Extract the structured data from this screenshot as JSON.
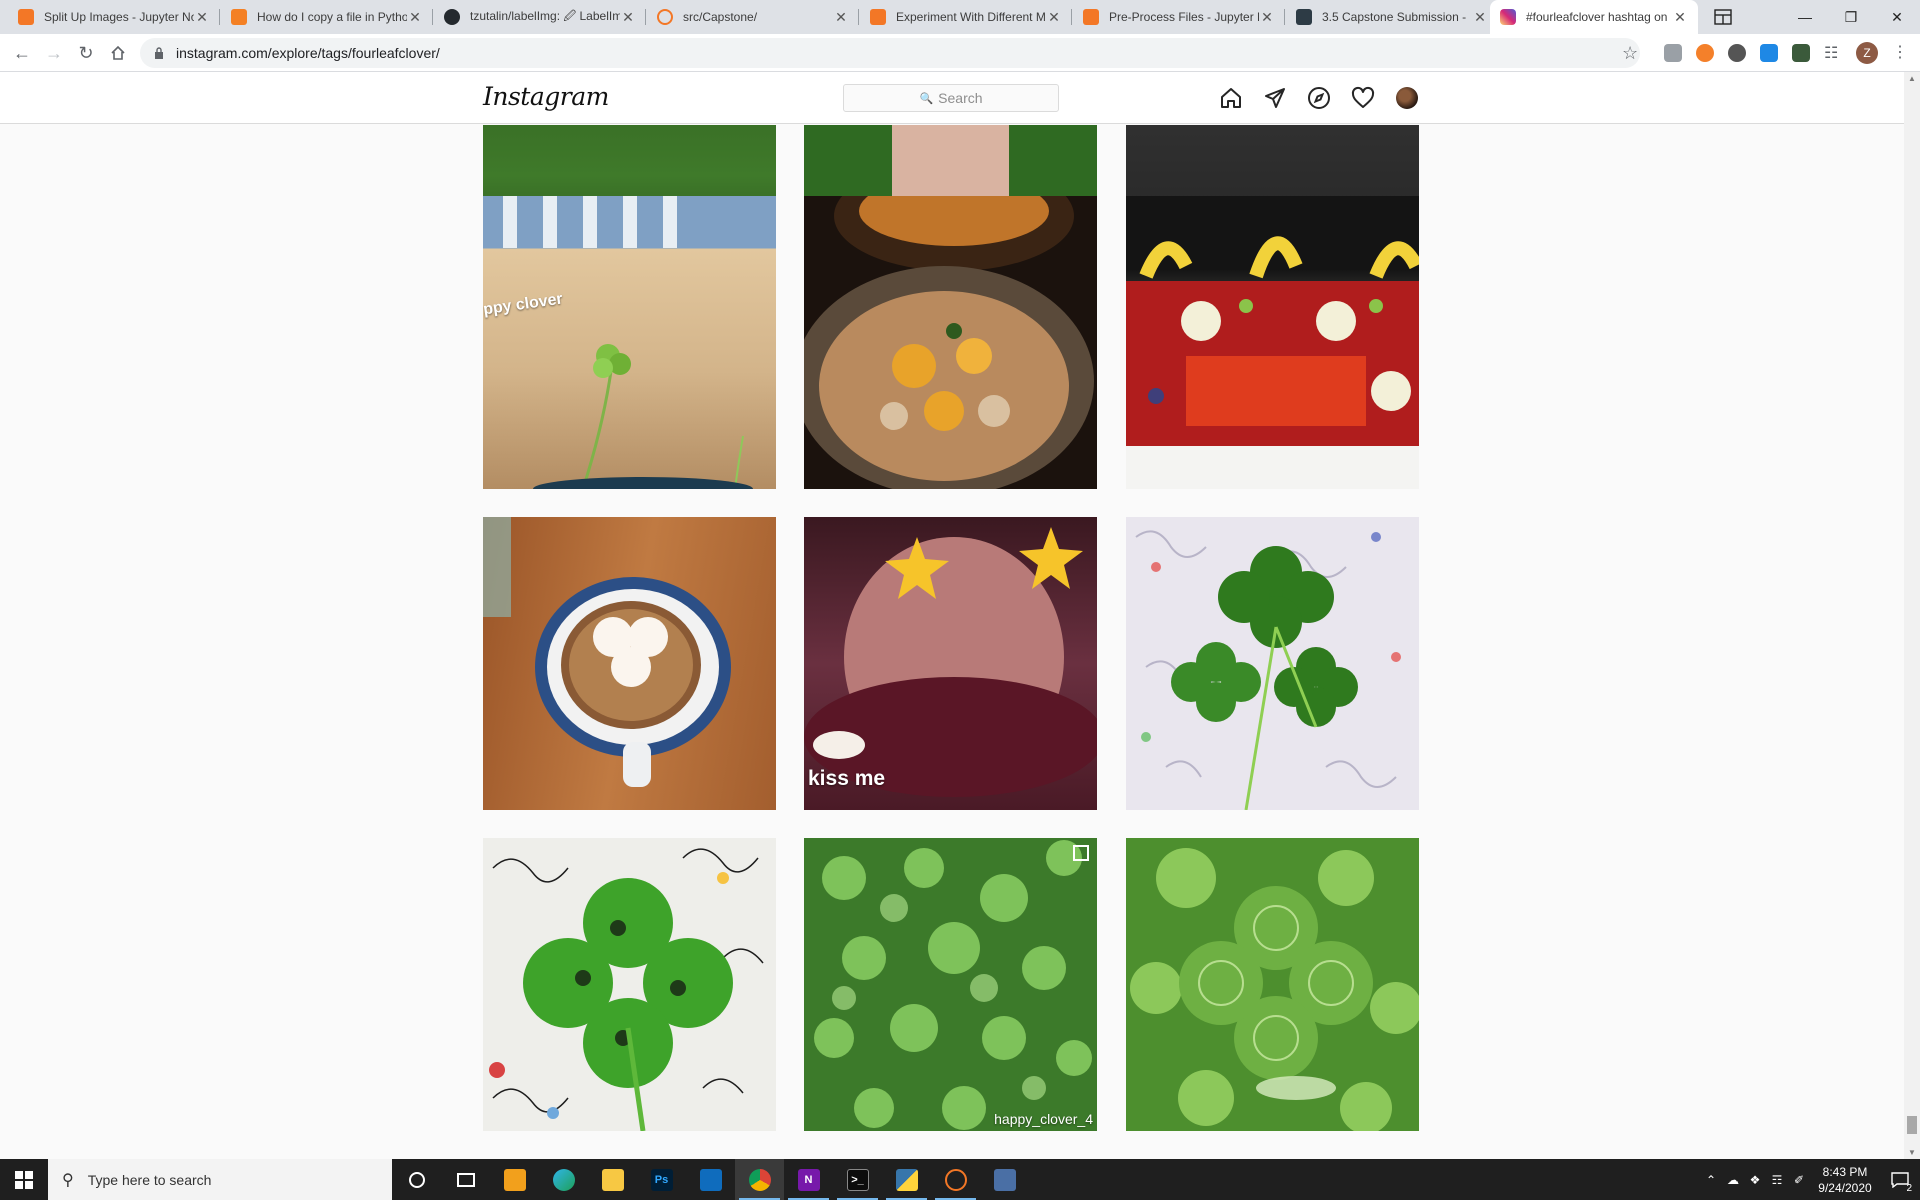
{
  "browser": {
    "tabs": [
      {
        "title": "Split Up Images - Jupyter Notebook",
        "favicon_color": "#f37726"
      },
      {
        "title": "How do I copy a file in Python?",
        "favicon_color": "#f48024"
      },
      {
        "title": "tzutalin/labelImg: 🖉 LabelImg",
        "favicon_color": "#24292e"
      },
      {
        "title": "src/Capstone/",
        "favicon_color": "#f37726"
      },
      {
        "title": "Experiment With Different Models",
        "favicon_color": "#f37726"
      },
      {
        "title": "Pre-Process Files - Jupyter Notebook",
        "favicon_color": "#f37726"
      },
      {
        "title": "3.5 Capstone Submission - ",
        "favicon_color": "#2d3b45"
      },
      {
        "title": "#fourleafclover hashtag on",
        "favicon_color": "#c13584"
      }
    ],
    "url": "instagram.com/explore/tags/fourleafclover/",
    "profile_initial": "Z"
  },
  "instagram": {
    "logo": "Instagram",
    "search_placeholder": "Search"
  },
  "posts": [
    {
      "caption": "ppy clover"
    },
    {
      "caption": ""
    },
    {
      "caption": ""
    },
    {
      "caption": ""
    },
    {
      "caption": "kiss me"
    },
    {
      "caption": ""
    },
    {
      "caption": ""
    },
    {
      "caption": "happy_clover_4"
    },
    {
      "caption": ""
    }
  ],
  "taskbar": {
    "search_placeholder": "Type here to search",
    "time": "8:43 PM",
    "date": "9/24/2020",
    "notification_count": "2"
  }
}
